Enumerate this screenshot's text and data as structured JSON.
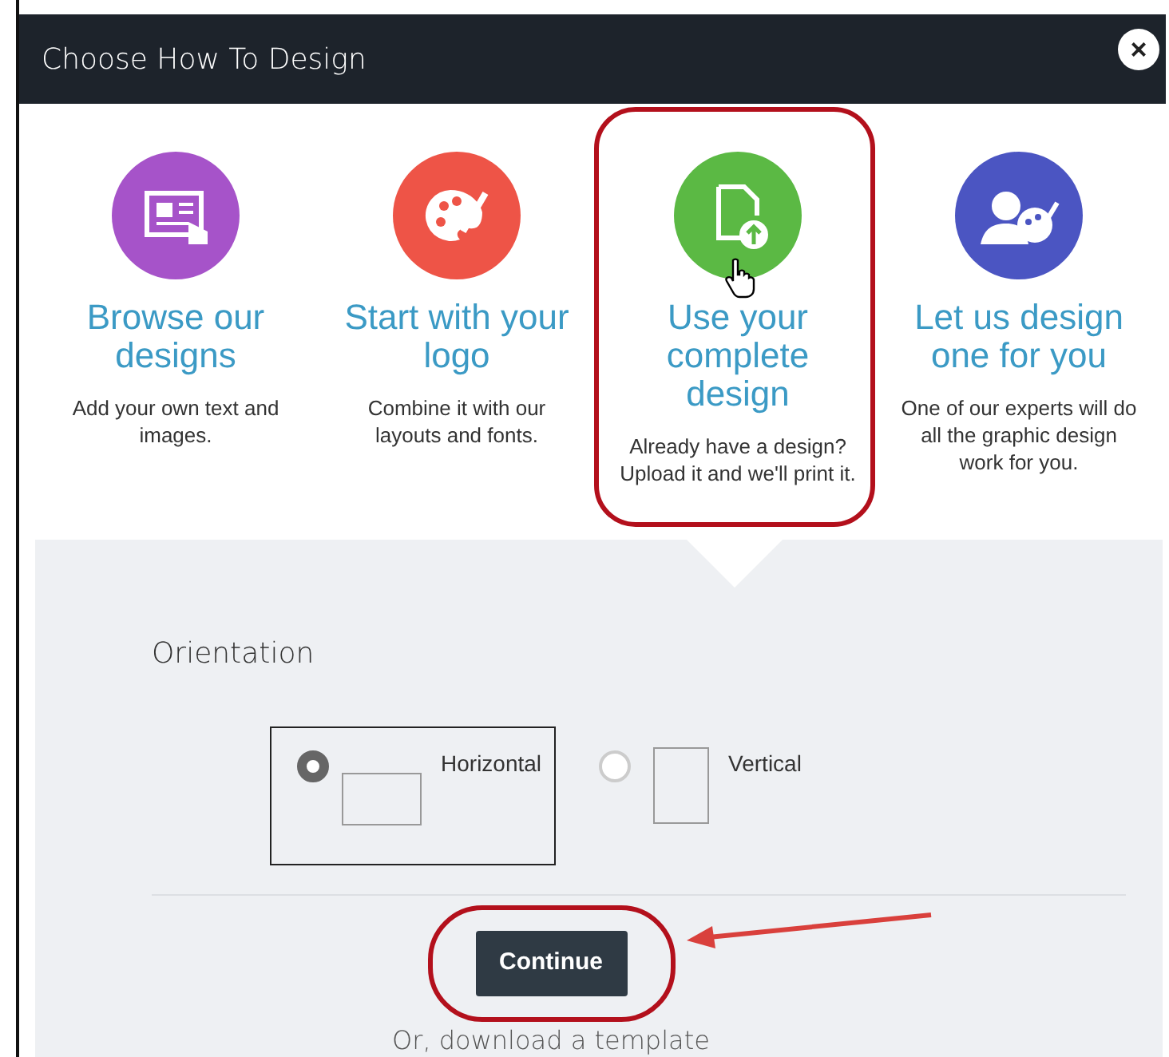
{
  "dialog": {
    "title": "Choose How To Design",
    "close_label": "×"
  },
  "options": [
    {
      "kind": "browse",
      "title": "Browse our designs",
      "description": "Add your own text and images.",
      "color": "#a653c9",
      "selected": false,
      "hovered": false,
      "highlighted": false
    },
    {
      "kind": "logo",
      "title": "Start with your logo",
      "description": "Combine it with our layouts and fonts.",
      "color": "#ee5447",
      "selected": false,
      "hovered": false,
      "highlighted": false
    },
    {
      "kind": "upload",
      "title": "Use your complete design",
      "description": "Already have a design? Upload it and we'll print it.",
      "color": "#5bb944",
      "selected": true,
      "hovered": true,
      "highlighted": true
    },
    {
      "kind": "expert",
      "title": "Let us design one for you",
      "description": "One of our experts will do all the graphic design work for you.",
      "color": "#4b55c2",
      "selected": false,
      "hovered": false,
      "highlighted": false
    }
  ],
  "orientation": {
    "label": "Orientation",
    "choices": [
      {
        "kind": "horizontal",
        "label": "Horizontal",
        "selected": true
      },
      {
        "kind": "vertical",
        "label": "Vertical",
        "selected": false
      }
    ]
  },
  "continue_button": {
    "label": "Continue",
    "highlighted": true,
    "annotation_arrow": true
  },
  "template_link": "Or, download a template"
}
